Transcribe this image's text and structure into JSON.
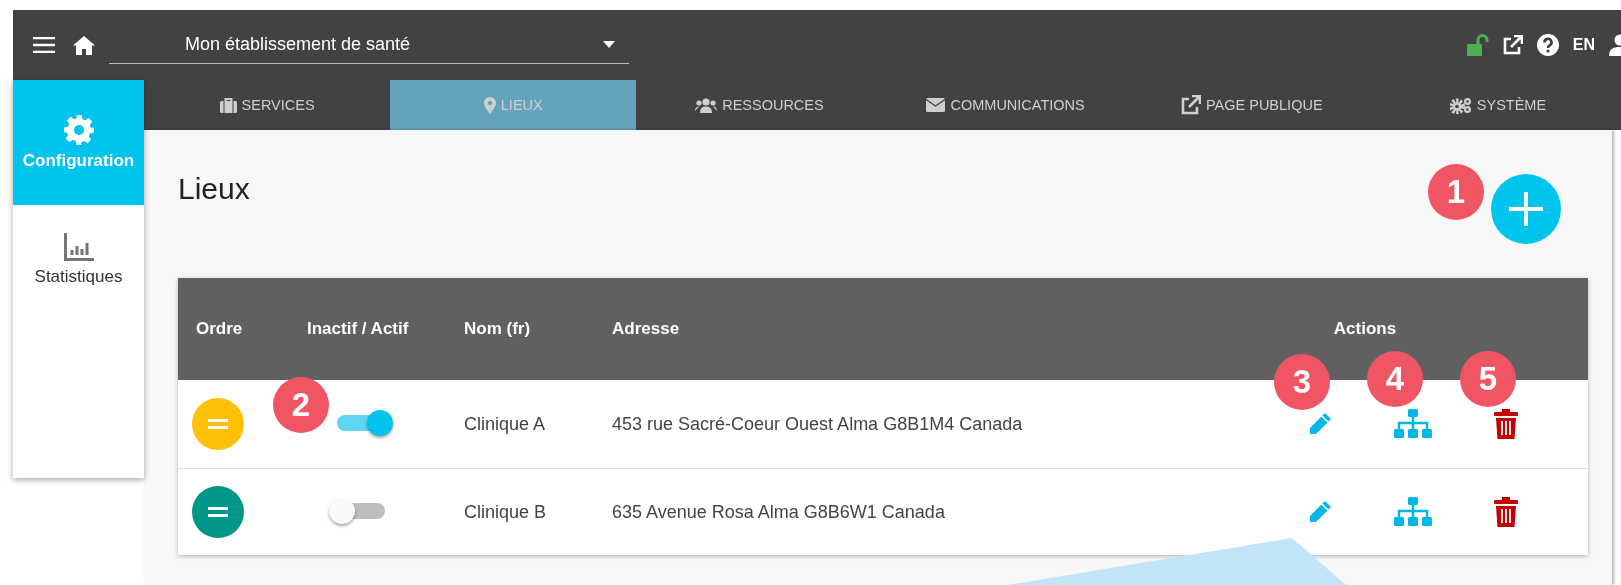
{
  "topbar": {
    "facility_select": {
      "value": "Mon établissement de santé"
    },
    "language": "EN"
  },
  "sidebar": {
    "items": [
      {
        "label": "Configuration",
        "selected": true
      },
      {
        "label": "Statistiques",
        "selected": false
      }
    ]
  },
  "tabs": [
    {
      "label": "SERVICES",
      "selected": false
    },
    {
      "label": "LIEUX",
      "selected": true
    },
    {
      "label": "RESSOURCES",
      "selected": false
    },
    {
      "label": "COMMUNICATIONS",
      "selected": false
    },
    {
      "label": "PAGE PUBLIQUE",
      "selected": false
    },
    {
      "label": "SYSTÈME",
      "selected": false
    }
  ],
  "page": {
    "title": "Lieux"
  },
  "table": {
    "columns": [
      "Ordre",
      "Inactif / Actif",
      "Nom (fr)",
      "Adresse",
      "Actions"
    ],
    "rows": [
      {
        "color": "#ffc107",
        "active": true,
        "name": "Clinique A",
        "address": "453 rue Sacré-Coeur Ouest Alma G8B1M4 Canada"
      },
      {
        "color": "#009688",
        "active": false,
        "name": "Clinique B",
        "address": "635 Avenue Rosa Alma G8B6W1 Canada"
      }
    ]
  },
  "callouts": [
    {
      "number": "1"
    },
    {
      "number": "2"
    },
    {
      "number": "3"
    },
    {
      "number": "4"
    },
    {
      "number": "5"
    }
  ]
}
